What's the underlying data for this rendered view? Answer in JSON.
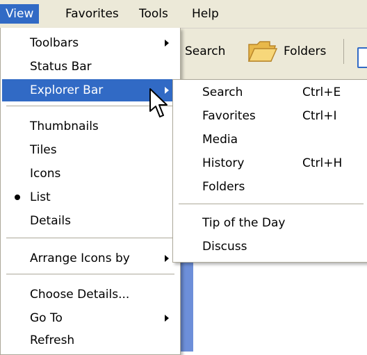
{
  "menubar": {
    "items": [
      {
        "label": "View"
      },
      {
        "label": "Favorites"
      },
      {
        "label": "Tools"
      },
      {
        "label": "Help"
      }
    ]
  },
  "toolbar": {
    "search_label": "Search",
    "folders_label": "Folders",
    "folders_icon": "folder-icon"
  },
  "view_menu": {
    "items": [
      {
        "label": "Toolbars",
        "submenu": true
      },
      {
        "label": "Status Bar"
      },
      {
        "label": "Explorer Bar",
        "submenu": true,
        "highlighted": true
      },
      {
        "label": "Thumbnails"
      },
      {
        "label": "Tiles"
      },
      {
        "label": "Icons"
      },
      {
        "label": "List",
        "checked": true
      },
      {
        "label": "Details"
      },
      {
        "label": "Arrange Icons by",
        "submenu": true
      },
      {
        "label": "Choose Details..."
      },
      {
        "label": "Go To",
        "submenu": true
      },
      {
        "label": "Refresh"
      }
    ]
  },
  "explorer_bar_menu": {
    "items": [
      {
        "label": "Search",
        "shortcut": "Ctrl+E"
      },
      {
        "label": "Favorites",
        "shortcut": "Ctrl+I"
      },
      {
        "label": "Media"
      },
      {
        "label": "History",
        "shortcut": "Ctrl+H"
      },
      {
        "label": "Folders"
      },
      {
        "label": "Tip of the Day"
      },
      {
        "label": "Discuss"
      }
    ]
  },
  "colors": {
    "highlight": "#316ac5",
    "menu_bar": "#ece9d8",
    "menu_border": "#aca899"
  }
}
